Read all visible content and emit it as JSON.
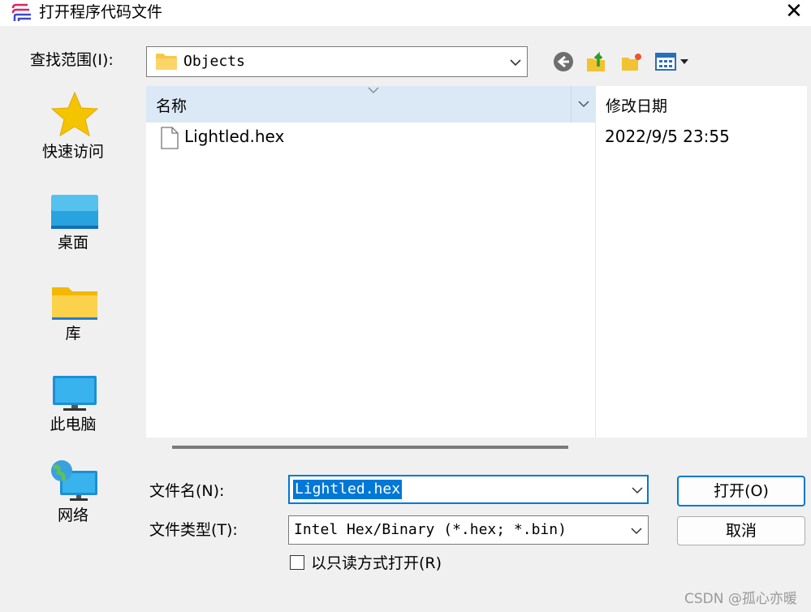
{
  "window": {
    "title": "打开程序代码文件",
    "close_glyph": "✕"
  },
  "lookin": {
    "label": "查找范围(I):",
    "value": "Objects"
  },
  "places": [
    {
      "label": "快速访问",
      "icon": "star-icon"
    },
    {
      "label": "桌面",
      "icon": "desktop-icon"
    },
    {
      "label": "库",
      "icon": "library-folder-icon"
    },
    {
      "label": "此电脑",
      "icon": "computer-icon"
    },
    {
      "label": "网络",
      "icon": "network-icon"
    }
  ],
  "columns": {
    "name": "名称",
    "date": "修改日期"
  },
  "files": [
    {
      "name": "Lightled.hex",
      "date": "2022/9/5 23:55"
    }
  ],
  "filename": {
    "label": "文件名(N):",
    "value": "Lightled.hex"
  },
  "filetype": {
    "label": "文件类型(T):",
    "value": "Intel Hex/Binary (*.hex; *.bin)"
  },
  "buttons": {
    "open": "打开(O)",
    "cancel": "取消"
  },
  "readonly": {
    "label": "以只读方式打开(R)",
    "checked": false
  },
  "watermark": "CSDN @孤心亦暖",
  "colors": {
    "accent": "#0078d7",
    "header_bg": "#dbe9f6",
    "folder": "#f8c843"
  }
}
